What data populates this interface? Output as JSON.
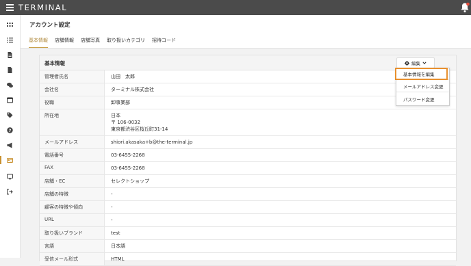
{
  "app": {
    "logo_text": "TERMINAL"
  },
  "sidebar": {
    "items": [
      {
        "icon": "grid-icon"
      },
      {
        "icon": "list-icon"
      },
      {
        "icon": "document-icon"
      },
      {
        "icon": "file-icon"
      },
      {
        "icon": "chat-icon"
      },
      {
        "icon": "window-icon"
      },
      {
        "icon": "tag-icon"
      },
      {
        "icon": "help-icon"
      },
      {
        "icon": "megaphone-icon"
      },
      {
        "icon": "id-card-icon",
        "active": true
      },
      {
        "icon": "monitor-icon"
      },
      {
        "icon": "logout-icon"
      }
    ]
  },
  "header": {
    "title": "アカウント設定",
    "tabs": [
      {
        "label": "基本情報",
        "active": true
      },
      {
        "label": "店舗情報"
      },
      {
        "label": "店舗写真"
      },
      {
        "label": "取り扱いカテゴリ"
      },
      {
        "label": "招待コード"
      }
    ]
  },
  "panel": {
    "title": "基本情報",
    "edit_label": "編集",
    "rows": [
      {
        "label": "管理者氏名",
        "value": "山田　太郎"
      },
      {
        "label": "会社名",
        "value": "ターミナル株式会社"
      },
      {
        "label": "役職",
        "value": "卸事業部"
      },
      {
        "label": "所在地",
        "value_lines": [
          "日本",
          "〒 106-0032",
          "東京都渋谷区桜丘町31-14"
        ]
      },
      {
        "label": "メールアドレス",
        "value": "shiori.akasaka+b@the-terminal.jp"
      },
      {
        "label": "電話番号",
        "value": "03-6455-2268"
      },
      {
        "label": "FAX",
        "value": "03-6455-2268"
      },
      {
        "label": "店舗・EC",
        "value": "セレクトショップ"
      },
      {
        "label": "店舗の特徴",
        "value": "-"
      },
      {
        "label": "顧客の特徴や傾向",
        "value": "-"
      },
      {
        "label": "URL",
        "value": "-"
      },
      {
        "label": "取り扱いブランド",
        "value": "test"
      },
      {
        "label": "言語",
        "value": "日本語"
      },
      {
        "label": "受信メール形式",
        "value": "HTML"
      }
    ]
  },
  "dropdown": {
    "items": [
      {
        "label": "基本情報を編集",
        "highlighted": true
      },
      {
        "label": "メールアドレス変更"
      },
      {
        "label": "パスワード変更"
      }
    ]
  },
  "colors": {
    "topbar": "#4b4b4b",
    "accent": "#c8a04a",
    "highlight": "#e8902e"
  }
}
